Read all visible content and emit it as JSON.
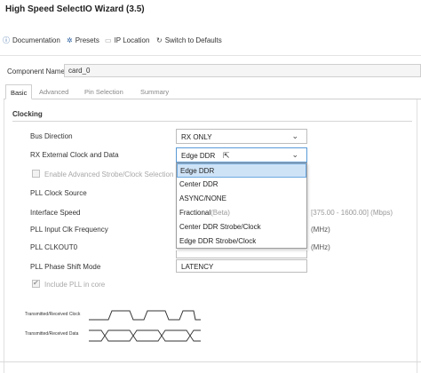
{
  "window": {
    "title": "High Speed SelectIO Wizard (3.5)"
  },
  "toolbar": {
    "documentation": "Documentation",
    "presets": "Presets",
    "ip_location": "IP Location",
    "switch_defaults": "Switch to Defaults"
  },
  "component": {
    "label": "Component Name",
    "value": "card_0"
  },
  "tabs": [
    "Basic",
    "Advanced",
    "Pin Selection",
    "Summary"
  ],
  "clocking": {
    "title": "Clocking",
    "bus_direction": {
      "label": "Bus Direction",
      "value": "RX ONLY"
    },
    "rx_clock_data": {
      "label": "RX External Clock and Data",
      "value": "Edge DDR"
    },
    "enable_advanced": {
      "label": "Enable Advanced Strobe/Clock Selection",
      "checked": false
    },
    "pll_clock_source": {
      "label": "PLL Clock Source"
    },
    "interface_speed": {
      "label": "Interface Speed",
      "range": "[375.00 - 1600.00] (Mbps)"
    },
    "pll_input_clk": {
      "label": "PLL Input Clk Frequency",
      "unit": "(MHz)"
    },
    "pll_clkout0": {
      "label": "PLL CLKOUT0",
      "unit": "(MHz)"
    },
    "pll_phase_shift": {
      "label": "PLL Phase Shift Mode",
      "value": "LATENCY"
    },
    "include_pll": {
      "label": "Include PLL in core",
      "checked": true
    }
  },
  "dropdown": {
    "options": [
      {
        "label": "Edge DDR",
        "selected": true
      },
      {
        "label": "Center DDR"
      },
      {
        "label": "ASYNC/NONE"
      },
      {
        "label": "Fractional",
        "hint": "(Beta)"
      },
      {
        "label": "Center DDR Strobe/Clock"
      },
      {
        "label": "Edge DDR Strobe/Clock"
      }
    ]
  },
  "waveform": {
    "clock_label": "Transmitted/Received Clock",
    "data_label": "Transmitted/Received Data"
  },
  "colors": {
    "accent": "#2a5fa0",
    "selection": "#cfe3f7",
    "selection_border": "#6aa8e0"
  }
}
